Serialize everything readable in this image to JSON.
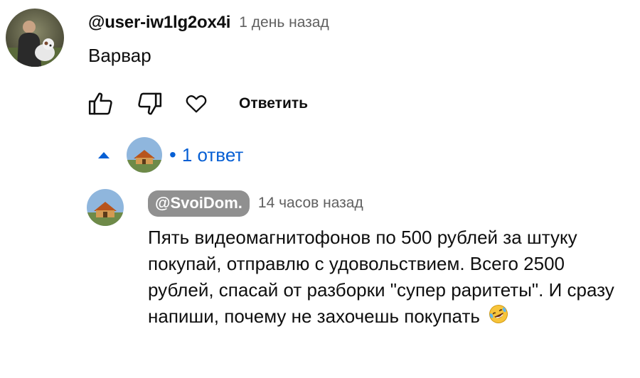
{
  "comment": {
    "author": "@user-iw1lg2ox4i",
    "timestamp": "1 день назад",
    "text": "Варвар",
    "reply_label": "Ответить",
    "icons": {
      "like": "thumbs-up-icon",
      "dislike": "thumbs-down-icon",
      "heart": "heart-icon"
    }
  },
  "replies_toggle": {
    "count_label": "1 ответ",
    "dot": "•",
    "arrow_icon": "caret-up-icon",
    "accent_color": "#065fd4"
  },
  "reply": {
    "author": "@SvoiDom.",
    "timestamp": "14 часов назад",
    "text": "Пять видеомагнитофонов по 500 рублей за штуку покупай, отправлю с удовольствием. Всего 2500 рублей, спасай от разборки \"супер раритеты\". И сразу напиши, почему не захочешь покупать",
    "emoji_icon": "rofl-emoji-icon",
    "author_chip_color": "#909090"
  },
  "colors": {
    "text": "#0f0f0f",
    "secondary": "#606060",
    "link": "#065fd4"
  }
}
